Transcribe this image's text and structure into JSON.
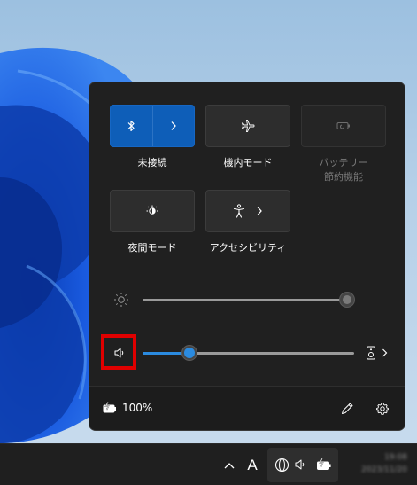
{
  "tiles": [
    {
      "label": "未接続",
      "icon": "bluetooth-icon",
      "state": "active",
      "has_chevron": true
    },
    {
      "label": "機内モード",
      "icon": "airplane-icon",
      "state": "off",
      "has_chevron": false
    },
    {
      "label": "バッテリー節約機能",
      "label_lines": [
        "バッテリー",
        "節約機能"
      ],
      "icon": "battery-saver-icon",
      "state": "disabled",
      "has_chevron": false
    },
    {
      "label": "夜間モード",
      "icon": "night-light-icon",
      "state": "off",
      "has_chevron": false
    },
    {
      "label": "アクセシビリティ",
      "icon": "accessibility-icon",
      "state": "off",
      "has_chevron": true
    }
  ],
  "brightness": {
    "icon": "sun-icon",
    "level": 1.0
  },
  "volume": {
    "icon": "speaker-icon",
    "level": 0.22,
    "output_icon": "speaker-device-icon"
  },
  "footer": {
    "battery": "100%",
    "battery_icon": "battery-charging-icon",
    "edit_icon": "pencil-icon",
    "settings_icon": "gear-icon"
  },
  "taskbar": {
    "overflow_icon": "chevron-up-icon",
    "ime": "A",
    "tray_icons": [
      "network-icon",
      "speaker-icon",
      "battery-charging-icon"
    ],
    "clock_time": "19:08",
    "clock_date": "2023/11/20"
  },
  "colors": {
    "accent": "#0e5eb8",
    "slider_fill": "#2b8be0",
    "highlight": "#e00000",
    "panel": "#202020"
  }
}
